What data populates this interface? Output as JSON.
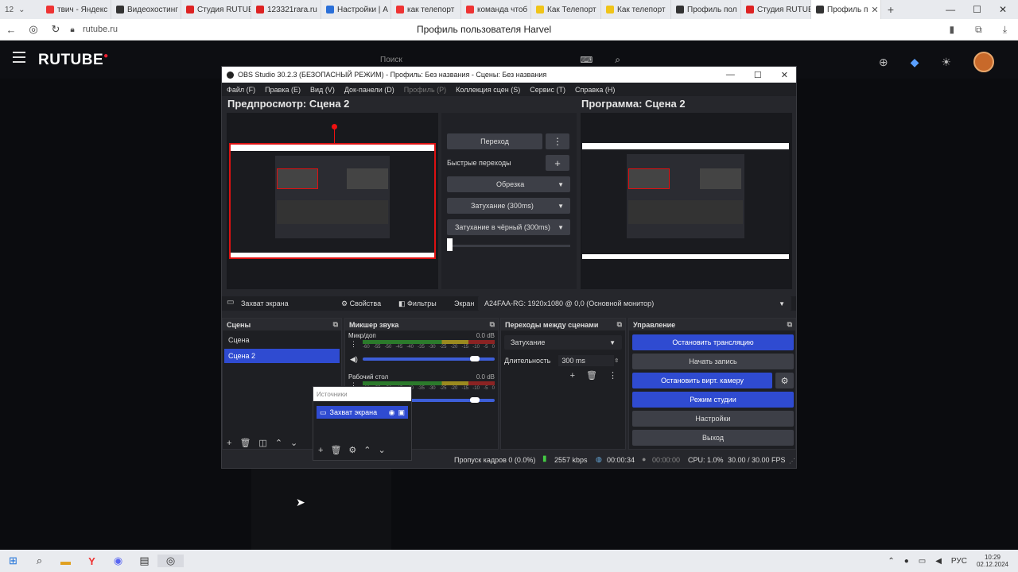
{
  "browser": {
    "tab_counter": "12",
    "tabs": [
      {
        "label": "твич - Яндекс",
        "color": "#e33"
      },
      {
        "label": "Видеохостинг",
        "color": "#333"
      },
      {
        "label": "Студия RUTUBE",
        "color": "#d22"
      },
      {
        "label": "123321rara.ru",
        "color": "#d22"
      },
      {
        "label": "Настройки | А",
        "color": "#2a6fd8"
      },
      {
        "label": "как телепорт",
        "color": "#e33"
      },
      {
        "label": "команда чтоб",
        "color": "#e33"
      },
      {
        "label": "Как Телепорт",
        "color": "#f0c419"
      },
      {
        "label": "Как телепорт",
        "color": "#f0c419"
      },
      {
        "label": "Профиль пол",
        "color": "#333"
      },
      {
        "label": "Студия RUTUB",
        "color": "#d22"
      },
      {
        "label": "Профиль п",
        "color": "#333",
        "active": true
      }
    ],
    "url": "rutube.ru",
    "page_title": "Профиль пользователя Harvel"
  },
  "rutube": {
    "logo": "RUTUBE",
    "search_placeholder": "Поиск"
  },
  "obs": {
    "title": "OBS Studio 30.2.3 (БЕЗОПАСНЫЙ РЕЖИМ) - Профиль: Без названия - Сцены: Без названия",
    "menu": [
      "Файл (F)",
      "Правка (E)",
      "Вид (V)",
      "Док-панели (D)",
      "Профиль (P)",
      "Коллекция сцен (S)",
      "Сервис (T)",
      "Справка (H)"
    ],
    "preview_label": "Предпросмотр: Сцена 2",
    "program_label": "Программа: Сцена 2",
    "transition_button": "Переход",
    "quick_transitions": "Быстрые переходы",
    "quick_items": [
      "Обрезка",
      "Затухание (300ms)",
      "Затухание в чёрный (300ms)"
    ],
    "source_bar": {
      "selected_source": "Захват экрана",
      "properties": "Свойства",
      "filters": "Фильтры",
      "screen_label": "Экран",
      "screen_value": "A24FAA-RG: 1920x1080 @ 0,0 (Основной монитор)"
    },
    "scenes": {
      "title": "Сцены",
      "items": [
        "Сцена",
        "Сцена 2"
      ],
      "selected_index": 1
    },
    "sources": {
      "title": "Источники",
      "items": [
        "Захват экрана"
      ]
    },
    "mixer": {
      "title": "Микшер звука",
      "channels": [
        {
          "name": "Микр/доп",
          "db": "0.0 dB",
          "level": 0.85
        },
        {
          "name": "Рабочий стол",
          "db": "0.0 dB",
          "level": 0.85
        }
      ],
      "scale": [
        "-60",
        "-55",
        "-50",
        "-45",
        "-40",
        "-35",
        "-30",
        "-25",
        "-20",
        "-15",
        "-10",
        "-5",
        "0"
      ]
    },
    "transitions": {
      "title": "Переходы между сценами",
      "type": "Затухание",
      "duration_label": "Длительность",
      "duration_value": "300 ms"
    },
    "controls": {
      "title": "Управление",
      "stop_stream": "Остановить трансляцию",
      "start_recording": "Начать запись",
      "stop_vcam": "Остановить вирт. камеру",
      "studio_mode": "Режим студии",
      "settings": "Настройки",
      "exit": "Выход"
    },
    "status": {
      "dropped": "Пропуск кадров 0 (0.0%)",
      "bitrate": "2557 kbps",
      "stream_time": "00:00:34",
      "rec_time": "00:00:00",
      "cpu": "CPU: 1.0%",
      "fps": "30.00 / 30.00 FPS"
    }
  },
  "taskbar": {
    "lang": "РУС",
    "time": "10:29",
    "date": "02.12.2024"
  },
  "colors": {
    "accent": "#2f4bd1",
    "selection_red": "#dd1111",
    "rutube_red": "#ee2233"
  }
}
